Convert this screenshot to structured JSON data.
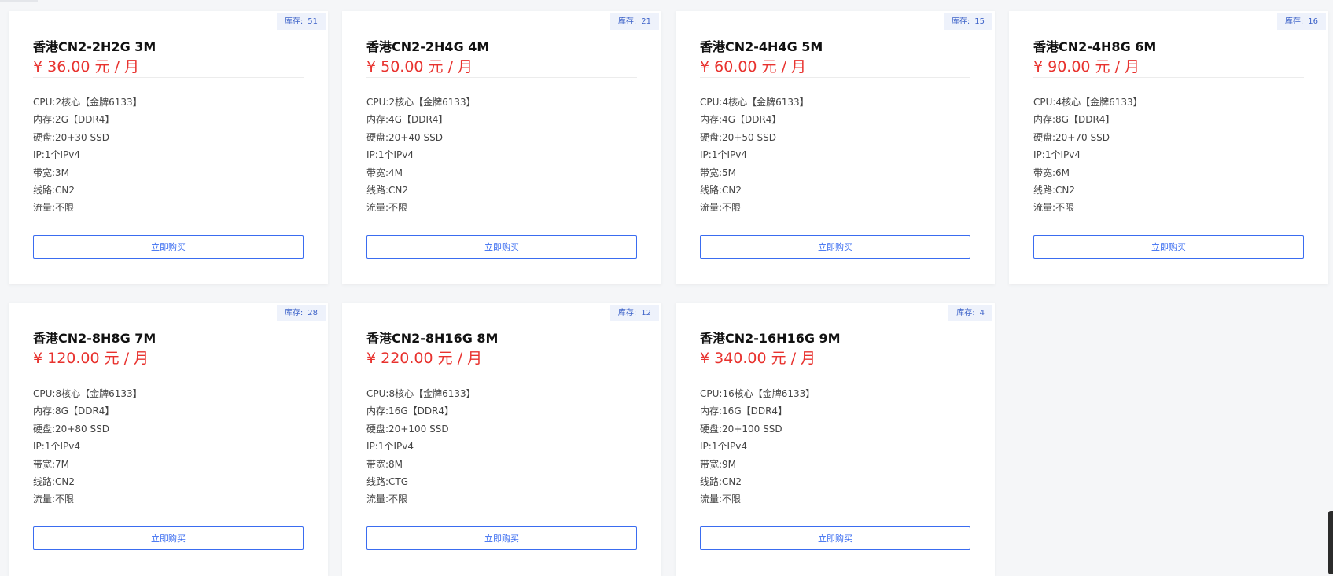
{
  "stock_label": "库存:",
  "buy_label": "立即购买",
  "spec_labels": {
    "cpu": "CPU:",
    "memory": "内存:",
    "disk": "硬盘:",
    "ip": "IP:",
    "bandwidth": "带宽:",
    "route": "线路:",
    "traffic": "流量:"
  },
  "products": [
    {
      "title": "香港CN2-2H2G 3M",
      "price": "¥ 36.00 元 / 月",
      "stock": "51",
      "cpu": "2核心【金牌6133】",
      "memory": "2G【DDR4】",
      "disk": "20+30 SSD",
      "ip": "1个IPv4",
      "bandwidth": "3M",
      "route": "CN2",
      "traffic": "不限"
    },
    {
      "title": "香港CN2-2H4G 4M",
      "price": "¥ 50.00 元 / 月",
      "stock": "21",
      "cpu": "2核心【金牌6133】",
      "memory": "4G【DDR4】",
      "disk": "20+40 SSD",
      "ip": "1个IPv4",
      "bandwidth": "4M",
      "route": "CN2",
      "traffic": "不限"
    },
    {
      "title": "香港CN2-4H4G 5M",
      "price": "¥ 60.00 元 / 月",
      "stock": "15",
      "cpu": "4核心【金牌6133】",
      "memory": "4G【DDR4】",
      "disk": "20+50 SSD",
      "ip": "1个IPv4",
      "bandwidth": "5M",
      "route": "CN2",
      "traffic": "不限"
    },
    {
      "title": "香港CN2-4H8G 6M",
      "price": "¥ 90.00 元 / 月",
      "stock": "16",
      "cpu": "4核心【金牌6133】",
      "memory": "8G【DDR4】",
      "disk": "20+70 SSD",
      "ip": "1个IPv4",
      "bandwidth": "6M",
      "route": "CN2",
      "traffic": "不限"
    },
    {
      "title": "香港CN2-8H8G 7M",
      "price": "¥ 120.00 元 / 月",
      "stock": "28",
      "cpu": "8核心【金牌6133】",
      "memory": "8G【DDR4】",
      "disk": "20+80 SSD",
      "ip": "1个IPv4",
      "bandwidth": "7M",
      "route": "CN2",
      "traffic": "不限"
    },
    {
      "title": "香港CN2-8H16G 8M",
      "price": "¥ 220.00 元 / 月",
      "stock": "12",
      "cpu": "8核心【金牌6133】",
      "memory": "16G【DDR4】",
      "disk": "20+100 SSD",
      "ip": "1个IPv4",
      "bandwidth": "8M",
      "route": "CTG",
      "traffic": "不限"
    },
    {
      "title": "香港CN2-16H16G 9M",
      "price": "¥ 340.00 元 / 月",
      "stock": "4",
      "cpu": "16核心【金牌6133】",
      "memory": "16G【DDR4】",
      "disk": "20+100 SSD",
      "ip": "1个IPv4",
      "bandwidth": "9M",
      "route": "CN2",
      "traffic": "不限"
    }
  ]
}
